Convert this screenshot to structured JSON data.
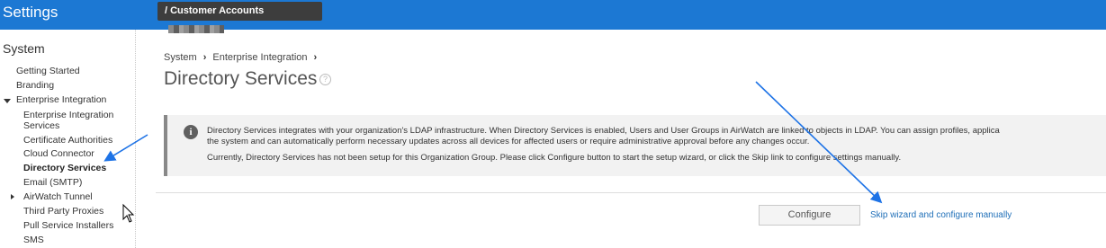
{
  "header": {
    "app_title": "Settings",
    "org_path": "/ Customer Accounts"
  },
  "sidebar": {
    "heading": "System",
    "items": [
      {
        "label": "Getting Started"
      },
      {
        "label": "Branding"
      },
      {
        "label": "Enterprise Integration"
      },
      {
        "label": "Enterprise Integration"
      },
      {
        "label": "Services"
      },
      {
        "label": "Certificate Authorities"
      },
      {
        "label": "Cloud Connector"
      },
      {
        "label": "Directory Services"
      },
      {
        "label": "Email (SMTP)"
      },
      {
        "label": "AirWatch Tunnel"
      },
      {
        "label": "Third Party Proxies"
      },
      {
        "label": "Pull Service Installers"
      },
      {
        "label": "SMS"
      }
    ]
  },
  "breadcrumb": {
    "items": [
      "System",
      "Enterprise Integration"
    ]
  },
  "page": {
    "title": "Directory Services",
    "help_glyph": "?"
  },
  "info": {
    "line1": "Directory Services integrates with your organization's LDAP infrastructure. When Directory Services is enabled, Users and User Groups in AirWatch are linked to objects in LDAP. You can assign profiles, applica",
    "line2": "the system and can automatically perform necessary updates across all devices for affected users or require administrative approval before any changes occur.",
    "line3": "Currently, Directory Services has not been setup for this Organization Group. Please click Configure button to start the setup wizard, or click the Skip link to configure settings manually."
  },
  "actions": {
    "configure_label": "Configure",
    "skip_label": "Skip wizard and configure manually"
  },
  "colors": {
    "header_bg": "#1c78d3",
    "link": "#1f6fb8",
    "annotation_arrow": "#1e73e6"
  }
}
